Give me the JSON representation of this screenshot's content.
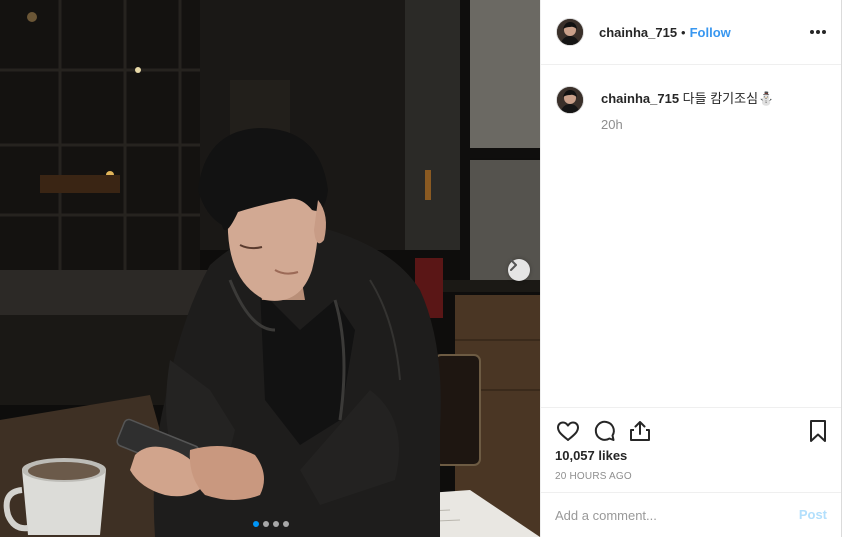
{
  "post": {
    "username": "chainha_715",
    "separator": "•",
    "follow_label": "Follow",
    "caption_username": "chainha_715",
    "caption_text": "다들 캄기조심⛄",
    "time_ago": "20h",
    "likes": "10,057 likes",
    "date": "20 HOURS AGO",
    "comment_placeholder": "Add a comment...",
    "post_label": "Post"
  },
  "carousel": {
    "slide_count": 4,
    "active_index": 0
  },
  "icons": {
    "more": "more-options-icon",
    "like": "heart-icon",
    "comment": "comment-bubble-icon",
    "share": "share-icon",
    "save": "bookmark-icon",
    "next": "chevron-right-icon"
  },
  "colors": {
    "link": "#3897f0",
    "muted": "#8e8e8e",
    "text": "#262626",
    "post_disabled": "#b2dffc"
  }
}
